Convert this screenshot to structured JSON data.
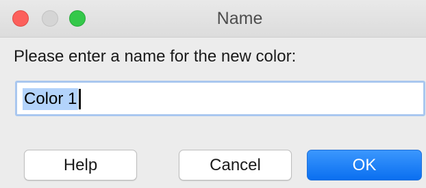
{
  "window": {
    "title": "Name"
  },
  "dialog": {
    "prompt": "Please enter a name for the new color:",
    "input_value": "Color 1"
  },
  "buttons": {
    "help": "Help",
    "cancel": "Cancel",
    "ok": "OK"
  },
  "colors": {
    "close": "#fc605c",
    "minimize": "#d5d5d5",
    "zoom": "#34c84a",
    "primary_button": "#0a6ff0",
    "selection": "#b3d3fb",
    "focus_ring": "#a9c7ef"
  }
}
